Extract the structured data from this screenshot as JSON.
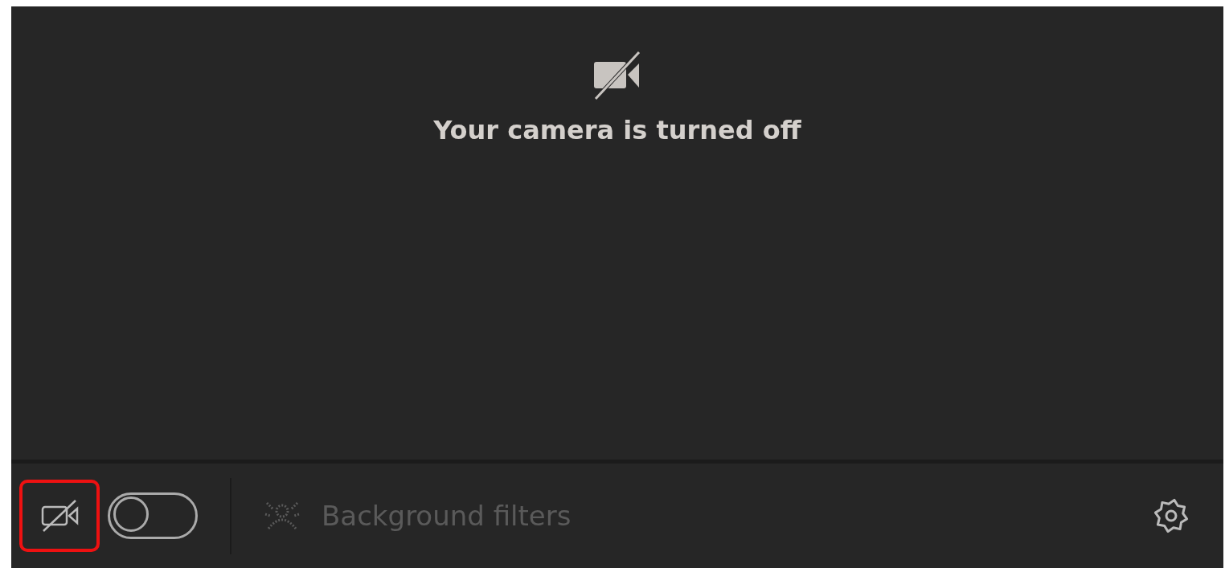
{
  "preview": {
    "message": "Your camera is turned off"
  },
  "toolbar": {
    "camera_button": {
      "highlighted": true
    },
    "camera_toggle": {
      "on": false
    },
    "background_filters": {
      "label": "Background filters",
      "disabled": true
    }
  }
}
